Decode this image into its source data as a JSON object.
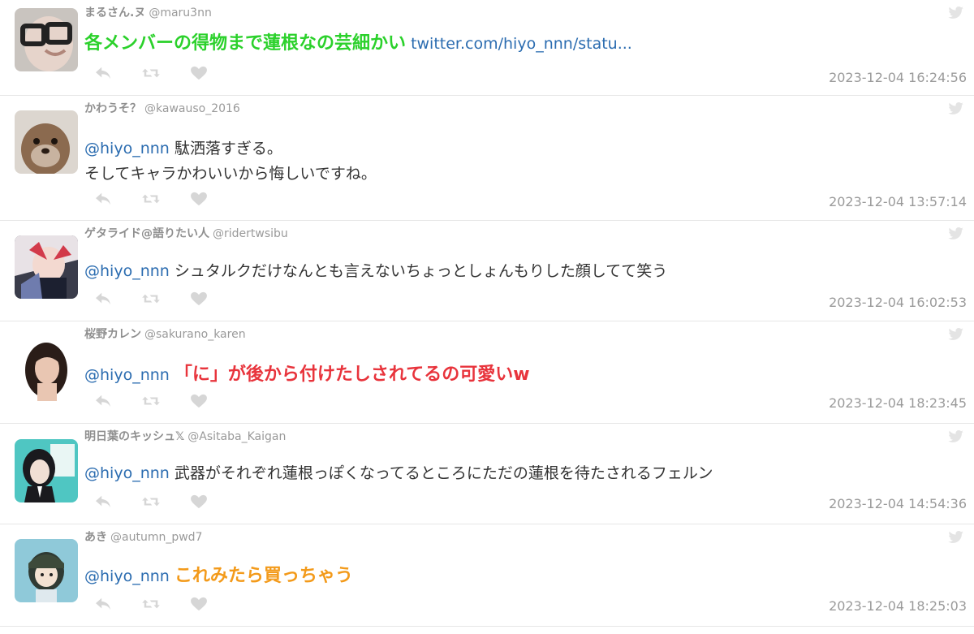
{
  "icons": {
    "reply": "reply-icon",
    "retweet": "retweet-icon",
    "like": "heart-icon",
    "twitter": "twitter-bird-icon"
  },
  "colors": {
    "mention": "#2b6cb0",
    "green_emphasis": "#2bd12b",
    "red_emphasis": "#e8343c",
    "orange_emphasis": "#f39a1a",
    "meta_gray": "#9a9a9a"
  },
  "tweets": [
    {
      "name": "まるさん.ヌ",
      "handle": "@maru3nn",
      "text": "各メンバーの得物まで蓮根なの芸細かい",
      "link": "twitter.com/hiyo_nnn/statu...",
      "timestamp": "2023-12-04 16:24:56"
    },
    {
      "name": "かわうそ？",
      "handle": "@kawauso_2016",
      "mention": "@hiyo_nnn",
      "text_line1": "駄洒落すぎる。",
      "text_line2": "そしてキャラかわいいから悔しいですね。",
      "timestamp": "2023-12-04 13:57:14"
    },
    {
      "name": "ゲタライド@語りたい人",
      "handle": "@ridertwsibu",
      "mention": "@hiyo_nnn",
      "text": "シュタルクだけなんとも言えないちょっとしょんもりした顔してて笑う",
      "timestamp": "2023-12-04 16:02:53"
    },
    {
      "name": "桜野カレン",
      "handle": "@sakurano_karen",
      "mention": "@hiyo_nnn",
      "text": "「に」が後から付けたしされてるの可愛いw",
      "timestamp": "2023-12-04 18:23:45"
    },
    {
      "name": "明日葉のキッシュ𝕏",
      "handle": "@Asitaba_Kaigan",
      "mention": "@hiyo_nnn",
      "text": "武器がそれぞれ蓮根っぽくなってるところにただの蓮根を待たされるフェルン",
      "timestamp": "2023-12-04 14:54:36"
    },
    {
      "name": "あき",
      "handle": "@autumn_pwd7",
      "mention": "@hiyo_nnn",
      "text": "これみたら買っちゃう",
      "timestamp": "2023-12-04 18:25:03"
    }
  ]
}
